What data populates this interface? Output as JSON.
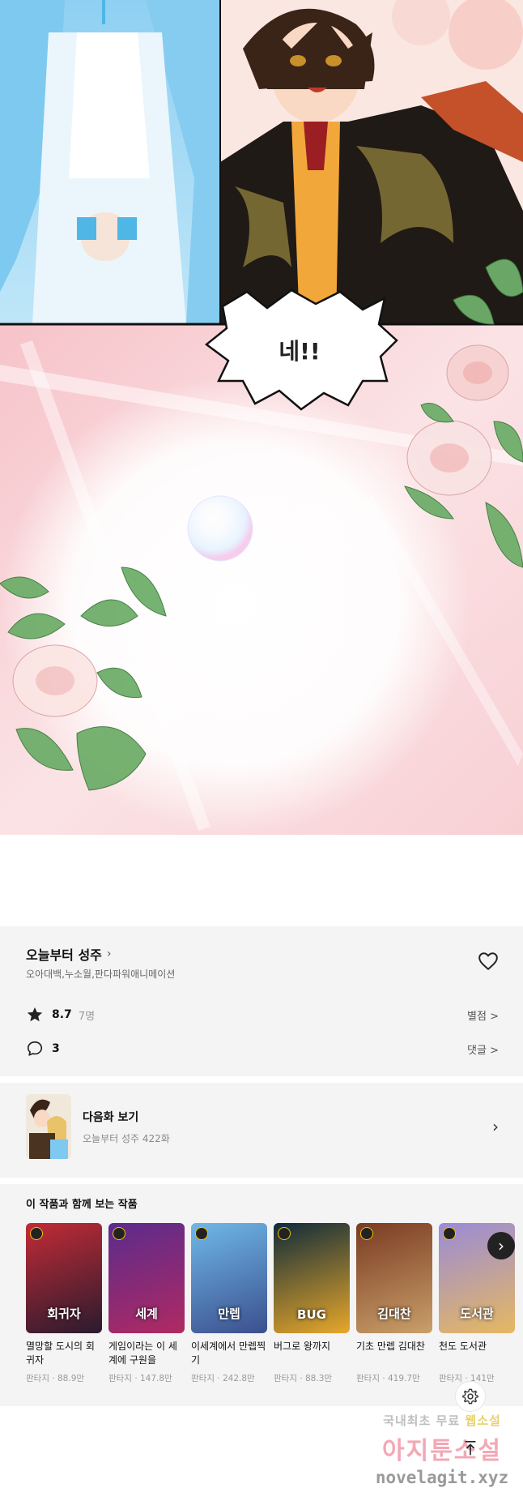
{
  "comic": {
    "speech": "네!!"
  },
  "work": {
    "title": "오늘부터 성주",
    "authors": "오아대백,누소월,판다파워애니메이션",
    "rating": "8.7",
    "rating_count": "7명",
    "rating_link": "별점 >",
    "comments": "3",
    "comments_link": "댓글 >"
  },
  "next_episode": {
    "label": "다음화 보기",
    "sub": "오늘부터 성주 422화"
  },
  "recommend": {
    "heading": "이 작품과 함께 보는 작품",
    "items": [
      {
        "title": "멸망할 도시의 회귀자",
        "meta": "판타지 · 88.9만",
        "cover_text": "회귀자",
        "color_a": "#c22b36",
        "color_b": "#2a1b2e"
      },
      {
        "title": "게임이라는 이 세계에 구원을",
        "meta": "판타지 · 147.8만",
        "cover_text": "세계",
        "color_a": "#5b2b8c",
        "color_b": "#b02a62"
      },
      {
        "title": "이세계에서 만렙찍기",
        "meta": "판타지 · 242.8만",
        "cover_text": "만렙",
        "color_a": "#6fb8e8",
        "color_b": "#3b4f8e"
      },
      {
        "title": "버그로 왕까지",
        "meta": "판타지 · 88.3만",
        "cover_text": "BUG",
        "color_a": "#0f2b3a",
        "color_b": "#e8a72a"
      },
      {
        "title": "기초 만렙 김대찬",
        "meta": "판타지 · 419.7만",
        "cover_text": "김대찬",
        "color_a": "#7a3b22",
        "color_b": "#c9a06a"
      },
      {
        "title": "천도 도서관",
        "meta": "판타지 · 141만",
        "cover_text": "도서관",
        "color_a": "#9a8bd8",
        "color_b": "#e6b860"
      }
    ]
  },
  "watermark": {
    "line1_a": "국내최초 무료",
    "line1_b": "웹소설",
    "line2": "아지툰소설",
    "line3": "novelagit.xyz"
  },
  "icons": {
    "heart": "heart-outline-icon",
    "star": "star-icon",
    "comment": "speech-bubble-icon",
    "settings": "gear-icon",
    "top": "arrow-up-to-top-icon",
    "next": "chevron-right-icon"
  }
}
